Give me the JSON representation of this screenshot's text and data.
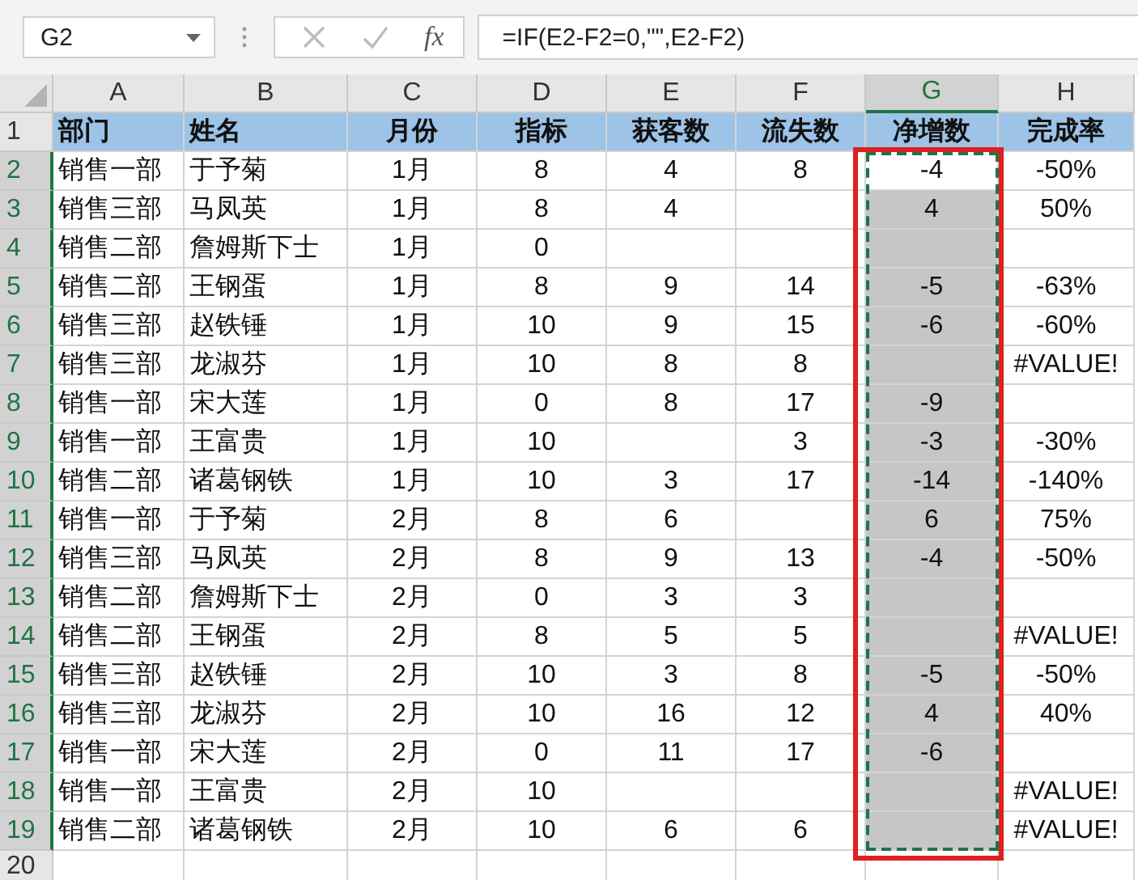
{
  "formula_bar": {
    "name_box": "G2",
    "fx": "fx",
    "formula": "=IF(E2-F2=0,\"\",E2-F2)"
  },
  "columns": [
    {
      "label": "A",
      "selected": false
    },
    {
      "label": "B",
      "selected": false
    },
    {
      "label": "C",
      "selected": false
    },
    {
      "label": "D",
      "selected": false
    },
    {
      "label": "E",
      "selected": false
    },
    {
      "label": "F",
      "selected": false
    },
    {
      "label": "G",
      "selected": true
    },
    {
      "label": "H",
      "selected": false
    }
  ],
  "rows": [
    {
      "number": "1",
      "kind": "header",
      "selected": false,
      "cells": [
        "部门",
        "姓名",
        "月份",
        "指标",
        "获客数",
        "流失数",
        "净增数",
        "完成率"
      ]
    },
    {
      "number": "2",
      "kind": "data",
      "selected": true,
      "active": true,
      "cells": [
        "销售一部",
        "于予菊",
        "1月",
        "8",
        "4",
        "8",
        "-4",
        "-50%"
      ]
    },
    {
      "number": "3",
      "kind": "data",
      "selected": true,
      "active": false,
      "cells": [
        "销售三部",
        "马凤英",
        "1月",
        "8",
        "4",
        null,
        "4",
        "50%"
      ]
    },
    {
      "number": "4",
      "kind": "data",
      "selected": true,
      "active": false,
      "cells": [
        "销售二部",
        "詹姆斯下士",
        "1月",
        "0",
        null,
        null,
        null,
        null
      ]
    },
    {
      "number": "5",
      "kind": "data",
      "selected": true,
      "active": false,
      "cells": [
        "销售二部",
        "王钢蛋",
        "1月",
        "8",
        "9",
        "14",
        "-5",
        "-63%"
      ]
    },
    {
      "number": "6",
      "kind": "data",
      "selected": true,
      "active": false,
      "cells": [
        "销售三部",
        "赵铁锤",
        "1月",
        "10",
        "9",
        "15",
        "-6",
        "-60%"
      ]
    },
    {
      "number": "7",
      "kind": "data",
      "selected": true,
      "active": false,
      "cells": [
        "销售三部",
        "龙淑芬",
        "1月",
        "10",
        "8",
        "8",
        null,
        "#VALUE!"
      ]
    },
    {
      "number": "8",
      "kind": "data",
      "selected": true,
      "active": false,
      "cells": [
        "销售一部",
        "宋大莲",
        "1月",
        "0",
        "8",
        "17",
        "-9",
        null
      ]
    },
    {
      "number": "9",
      "kind": "data",
      "selected": true,
      "active": false,
      "cells": [
        "销售一部",
        "王富贵",
        "1月",
        "10",
        null,
        "3",
        "-3",
        "-30%"
      ]
    },
    {
      "number": "10",
      "kind": "data",
      "selected": true,
      "active": false,
      "cells": [
        "销售二部",
        "诸葛钢铁",
        "1月",
        "10",
        "3",
        "17",
        "-14",
        "-140%"
      ]
    },
    {
      "number": "11",
      "kind": "data",
      "selected": true,
      "active": false,
      "cells": [
        "销售一部",
        "于予菊",
        "2月",
        "8",
        "6",
        null,
        "6",
        "75%"
      ]
    },
    {
      "number": "12",
      "kind": "data",
      "selected": true,
      "active": false,
      "cells": [
        "销售三部",
        "马凤英",
        "2月",
        "8",
        "9",
        "13",
        "-4",
        "-50%"
      ]
    },
    {
      "number": "13",
      "kind": "data",
      "selected": true,
      "active": false,
      "cells": [
        "销售二部",
        "詹姆斯下士",
        "2月",
        "0",
        "3",
        "3",
        null,
        null
      ]
    },
    {
      "number": "14",
      "kind": "data",
      "selected": true,
      "active": false,
      "cells": [
        "销售二部",
        "王钢蛋",
        "2月",
        "8",
        "5",
        "5",
        null,
        "#VALUE!"
      ]
    },
    {
      "number": "15",
      "kind": "data",
      "selected": true,
      "active": false,
      "cells": [
        "销售三部",
        "赵铁锤",
        "2月",
        "10",
        "3",
        "8",
        "-5",
        "-50%"
      ]
    },
    {
      "number": "16",
      "kind": "data",
      "selected": true,
      "active": false,
      "cells": [
        "销售三部",
        "龙淑芬",
        "2月",
        "10",
        "16",
        "12",
        "4",
        "40%"
      ]
    },
    {
      "number": "17",
      "kind": "data",
      "selected": true,
      "active": false,
      "cells": [
        "销售一部",
        "宋大莲",
        "2月",
        "0",
        "11",
        "17",
        "-6",
        null
      ]
    },
    {
      "number": "18",
      "kind": "data",
      "selected": true,
      "active": false,
      "cells": [
        "销售一部",
        "王富贵",
        "2月",
        "10",
        null,
        null,
        null,
        "#VALUE!"
      ]
    },
    {
      "number": "19",
      "kind": "data",
      "selected": true,
      "active": false,
      "cells": [
        "销售二部",
        "诸葛钢铁",
        "2月",
        "10",
        "6",
        "6",
        null,
        "#VALUE!"
      ]
    },
    {
      "number": "20",
      "kind": "data",
      "selected": false
    }
  ]
}
